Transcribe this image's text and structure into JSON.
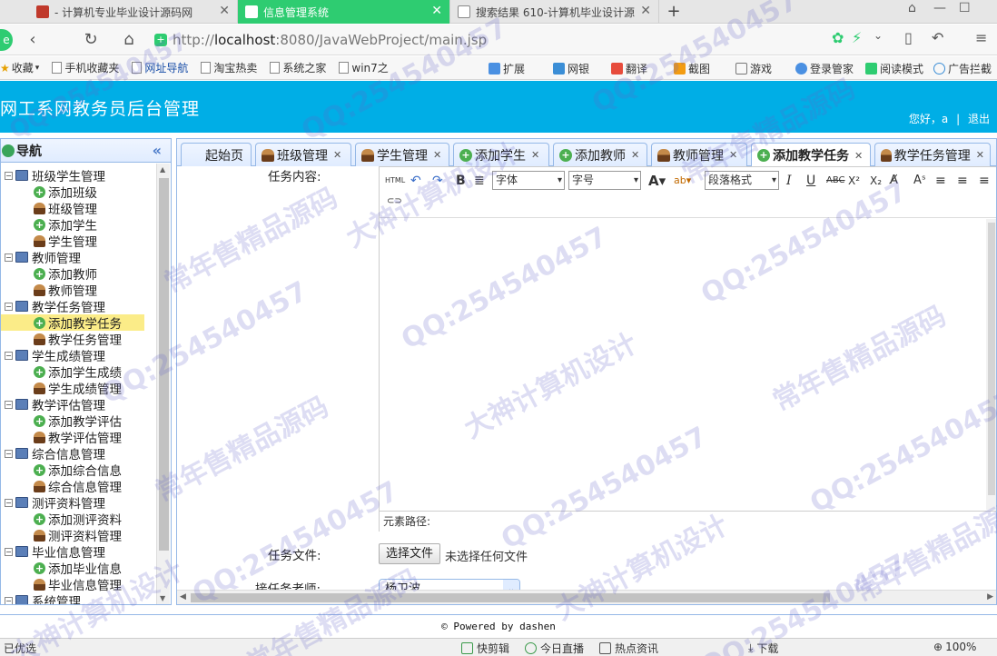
{
  "browser": {
    "tabs": [
      {
        "title": "- 计算机专业毕业设计源码网"
      },
      {
        "title": "信息管理系统"
      },
      {
        "title": "搜索结果 610-计算机毕业设计源"
      }
    ],
    "url_prefix": "http://",
    "url_host": "localhost",
    "url_rest": ":8080/JavaWebProject/main.jsp",
    "bookmarks": [
      "收藏",
      "手机收藏夹",
      "网址导航",
      "淘宝热卖",
      "系统之家",
      "win7之"
    ],
    "bookmarks_right": [
      "扩展",
      "网银",
      "翻译",
      "截图",
      "游戏",
      "登录管家",
      "阅读模式",
      "广告拦截"
    ],
    "status_left": "已优选",
    "status_items": [
      "快剪辑",
      "今日直播",
      "热点资讯",
      "下载"
    ],
    "zoom": "100%"
  },
  "app": {
    "title": "网工系网教务员后台管理",
    "welcome": "您好，a",
    "logout": "退出",
    "footer": "© Powered by dashen"
  },
  "sidebar": {
    "title": "导航",
    "groups": [
      {
        "label": "班级学生管理",
        "items": [
          "添加班级",
          "班级管理",
          "添加学生",
          "学生管理"
        ]
      },
      {
        "label": "教师管理",
        "items": [
          "添加教师",
          "教师管理"
        ]
      },
      {
        "label": "教学任务管理",
        "items": [
          "添加教学任务",
          "教学任务管理"
        ]
      },
      {
        "label": "学生成绩管理",
        "items": [
          "添加学生成绩",
          "学生成绩管理"
        ]
      },
      {
        "label": "教学评估管理",
        "items": [
          "添加教学评估",
          "教学评估管理"
        ]
      },
      {
        "label": "综合信息管理",
        "items": [
          "添加综合信息",
          "综合信息管理"
        ]
      },
      {
        "label": "测评资料管理",
        "items": [
          "添加测评资料",
          "测评资料管理"
        ]
      },
      {
        "label": "毕业信息管理",
        "items": [
          "添加毕业信息",
          "毕业信息管理"
        ]
      },
      {
        "label": "系统管理",
        "items": []
      }
    ],
    "selected": "添加教学任务"
  },
  "content_tabs": [
    {
      "label": "起始页"
    },
    {
      "label": "班级管理",
      "icon": "user-icon"
    },
    {
      "label": "学生管理",
      "icon": "user-icon"
    },
    {
      "label": "添加学生",
      "icon": "add-icon"
    },
    {
      "label": "添加教师",
      "icon": "add-icon"
    },
    {
      "label": "教师管理",
      "icon": "user-icon"
    },
    {
      "label": "添加教学任务",
      "icon": "add-icon",
      "active": true
    },
    {
      "label": "教学任务管理",
      "icon": "user-icon"
    }
  ],
  "form": {
    "content_label": "任务内容:",
    "file_label": "任务文件:",
    "teacher_label": "接任务老师:",
    "file_button": "选择文件",
    "file_status": "未选择任何文件",
    "teacher_value": "杨卫波",
    "editor": {
      "html_btn": "HTML",
      "font_select": "字体",
      "size_select": "字号",
      "para_select": "段落格式",
      "path_label": "元素路径:"
    }
  },
  "watermarks": [
    "QQ:254540457",
    "大神计算机设计",
    "常年售精品源码"
  ],
  "colors": {
    "header": "#00aee6",
    "active_tab": "#2ecc71",
    "panel_border": "#95b8e7",
    "selected_node": "#fbec88"
  }
}
